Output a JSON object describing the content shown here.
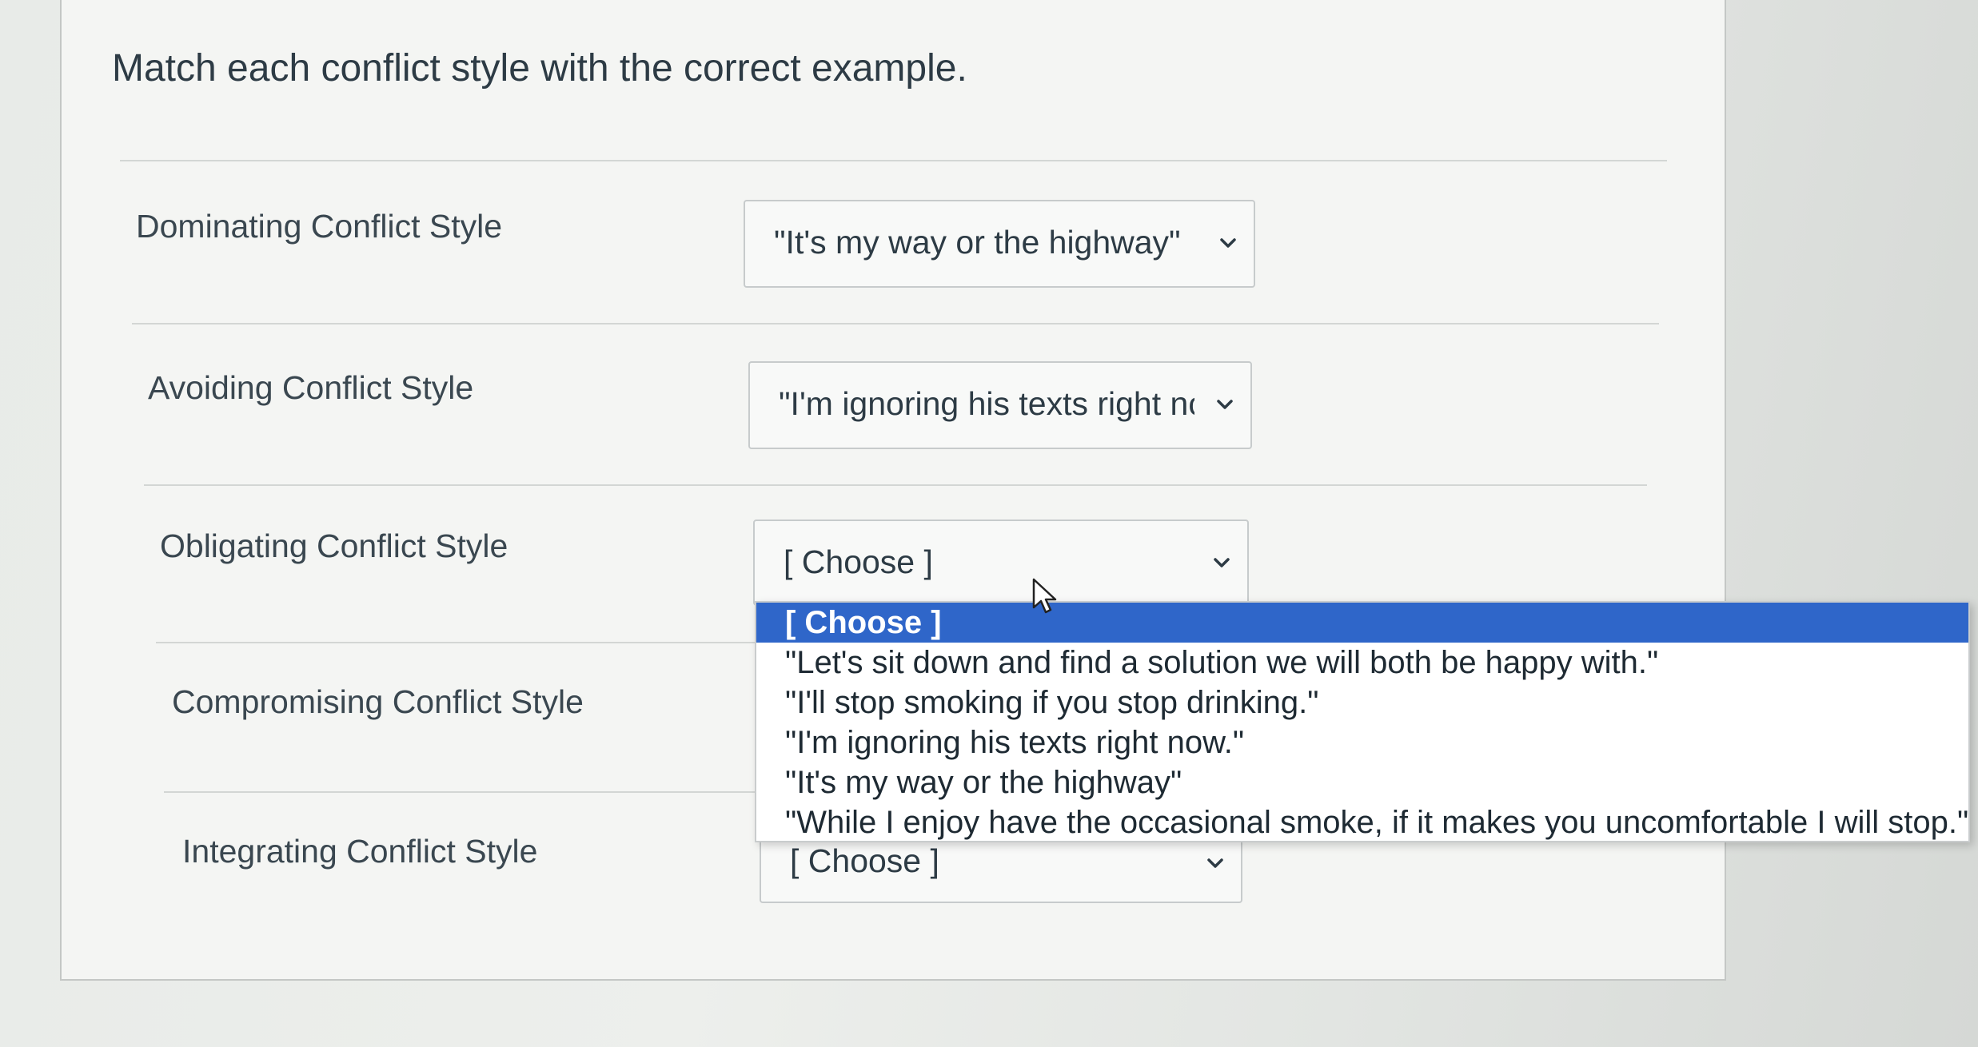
{
  "question": {
    "prompt": "Match each conflict style with the correct example."
  },
  "rows": [
    {
      "label": "Dominating Conflict Style",
      "selected": "\"It's my way or the highway\""
    },
    {
      "label": "Avoiding Conflict Style",
      "selected": "\"I'm ignoring his texts right nc"
    },
    {
      "label": "Obligating Conflict Style",
      "selected": "[ Choose ]"
    },
    {
      "label": "Compromising Conflict Style",
      "selected": ""
    },
    {
      "label": "Integrating Conflict Style",
      "selected": "[ Choose ]"
    }
  ],
  "dropdown": {
    "options": [
      "[ Choose ]",
      "\"Let's sit down and find a solution we will both be happy with.\"",
      "\"I'll stop smoking if you stop drinking.\"",
      "\"I'm ignoring his texts right now.\"",
      "\"It's my way or the highway\"",
      "\"While I enjoy have the occasional smoke, if it makes you uncomfortable I will stop.\""
    ],
    "highlighted_index": 0
  },
  "icons": {
    "select_arrow": "chevron-down-icon",
    "cursor": "mouse-pointer-icon"
  },
  "colors": {
    "highlight": "#2f66c9",
    "text": "#2d3b45",
    "border": "#c7cbcc"
  }
}
